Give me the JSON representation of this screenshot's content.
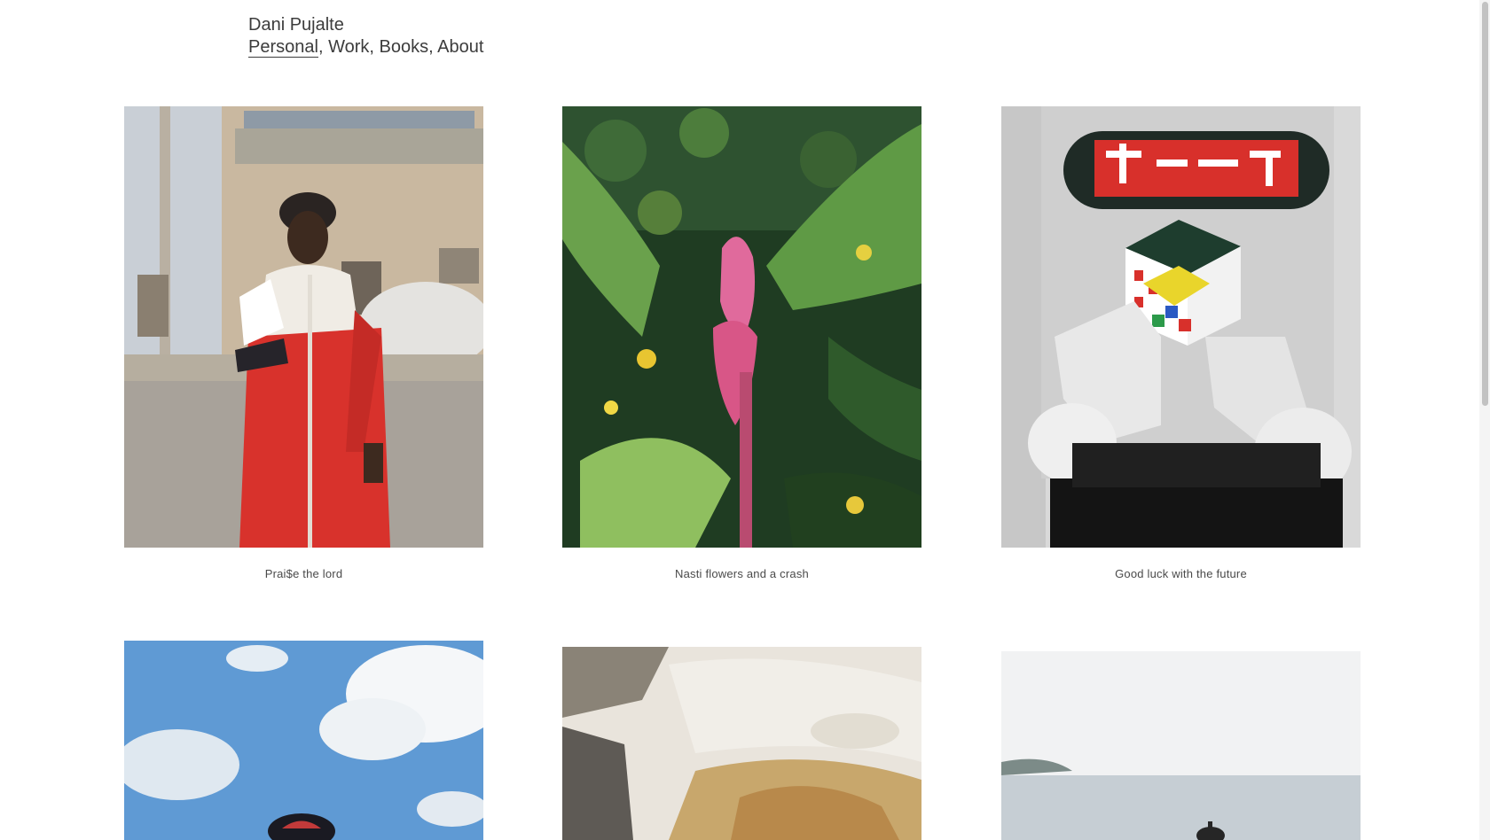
{
  "site": {
    "title": "Dani Pujalte"
  },
  "nav": {
    "items": [
      {
        "label": "Personal",
        "active": true
      },
      {
        "label": "Work",
        "active": false
      },
      {
        "label": "Books",
        "active": false
      },
      {
        "label": "About",
        "active": false
      }
    ],
    "separator": ", "
  },
  "gallery": [
    {
      "caption": "Prai$e the lord",
      "image": "portrait-red-tracksuit"
    },
    {
      "caption": "Nasti flowers and a crash",
      "image": "banana-flower-plant"
    },
    {
      "caption": "Good luck with the future",
      "image": "rubik-cube-robot"
    },
    {
      "caption": "",
      "image": "sky-clouds-cap"
    },
    {
      "caption": "",
      "image": "white-rock-quarry"
    },
    {
      "caption": "",
      "image": "sea-horizon-figure"
    }
  ],
  "colors": {
    "text": "#3c3c3c",
    "background": "#ffffff"
  }
}
